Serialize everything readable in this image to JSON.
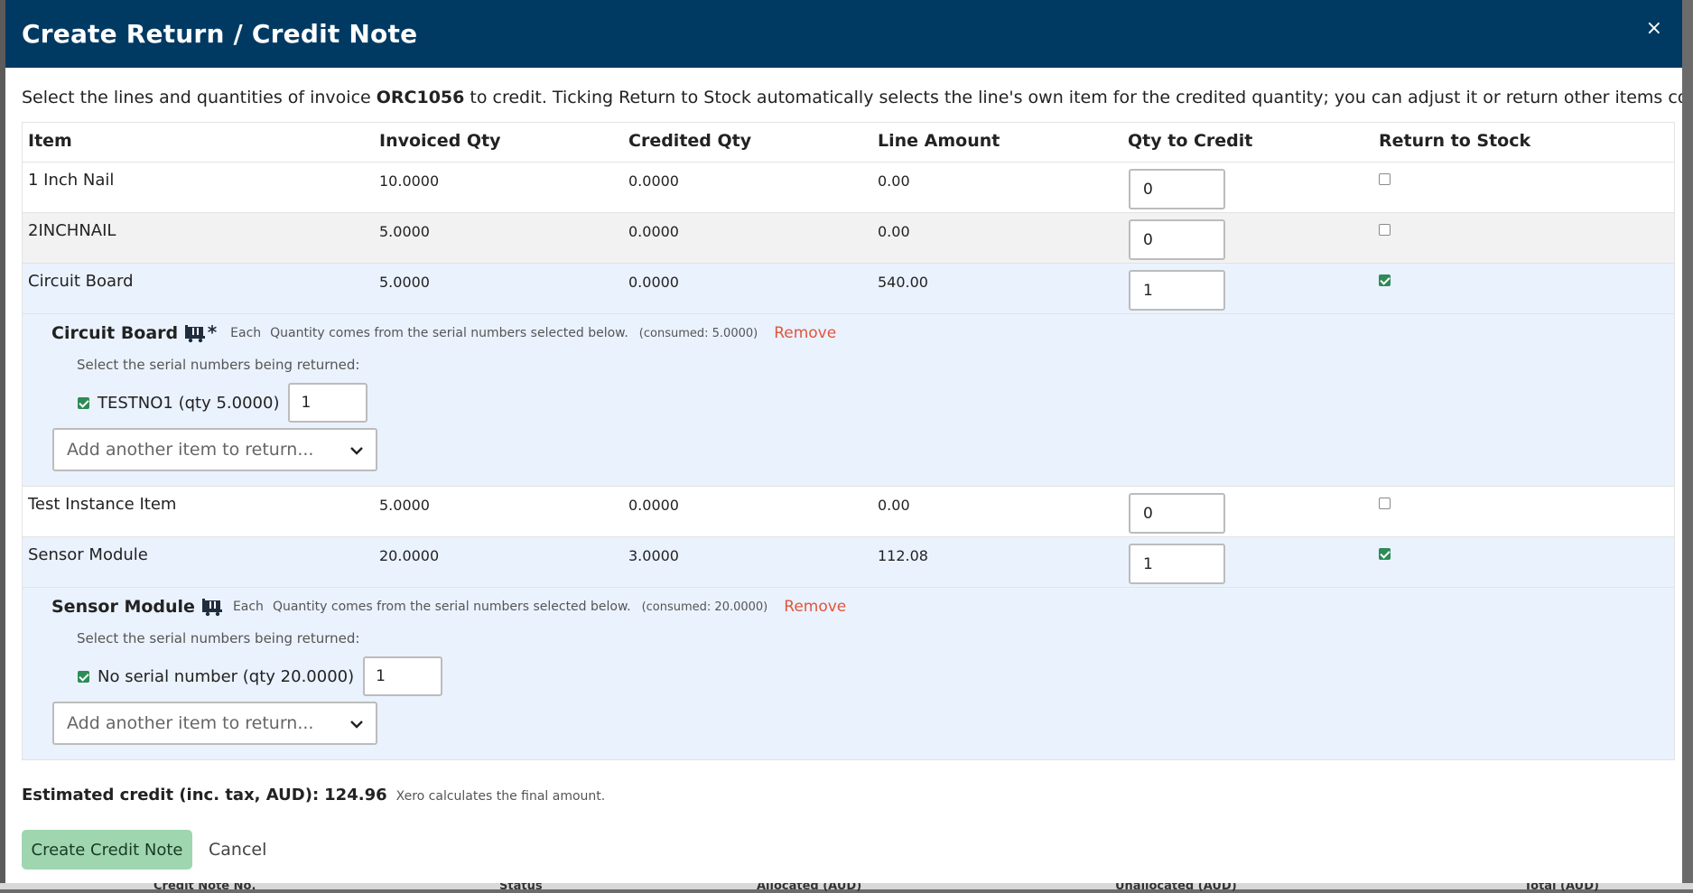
{
  "modal": {
    "title": "Create Return / Credit Note",
    "close_glyph": "×",
    "intro_before": "Select the lines and quantities of invoice ",
    "invoice_number": "ORC1056",
    "intro_after": " to credit. Ticking Return to Stock automatically selects the line's own item for the credited quantity; you can adjust it or return other items consumed on the job."
  },
  "table": {
    "headers": {
      "item": "Item",
      "invoiced_qty": "Invoiced Qty",
      "credited_qty": "Credited Qty",
      "line_amount": "Line Amount",
      "qty_to_credit": "Qty to Credit",
      "return_to_stock": "Return to Stock"
    },
    "rows": [
      {
        "item": "1 Inch Nail",
        "invoiced_qty": "10.0000",
        "credited_qty": "0.0000",
        "line_amount": "0.00",
        "qty_to_credit": "0",
        "return_to_stock": false
      },
      {
        "item": "2INCHNAIL",
        "invoiced_qty": "5.0000",
        "credited_qty": "0.0000",
        "line_amount": "0.00",
        "qty_to_credit": "0",
        "return_to_stock": false
      },
      {
        "item": "Circuit Board",
        "invoiced_qty": "5.0000",
        "credited_qty": "0.0000",
        "line_amount": "540.00",
        "qty_to_credit": "1",
        "return_to_stock": true
      },
      {
        "item": "Test Instance Item",
        "invoiced_qty": "5.0000",
        "credited_qty": "0.0000",
        "line_amount": "0.00",
        "qty_to_credit": "0",
        "return_to_stock": false
      },
      {
        "item": "Sensor Module",
        "invoiced_qty": "20.0000",
        "credited_qty": "3.0000",
        "line_amount": "112.08",
        "qty_to_credit": "1",
        "return_to_stock": true
      }
    ],
    "details": [
      {
        "name": "Circuit Board",
        "icon": "cart-star-icon",
        "unit": "Each",
        "note": "Quantity comes from the serial numbers selected below.",
        "consumed": "(consumed: 5.0000)",
        "remove_label": "Remove",
        "sub_label": "Select the serial numbers being returned:",
        "serial_label": "TESTNO1 (qty 5.0000)",
        "serial_checked": true,
        "serial_qty": "1",
        "add_placeholder": "Add another item to return..."
      },
      {
        "name": "Sensor Module",
        "icon": "cart-icon",
        "unit": "Each",
        "note": "Quantity comes from the serial numbers selected below.",
        "consumed": "(consumed: 20.0000)",
        "remove_label": "Remove",
        "sub_label": "Select the serial numbers being returned:",
        "serial_label": "No serial number (qty 20.0000)",
        "serial_checked": true,
        "serial_qty": "1",
        "add_placeholder": "Add another item to return..."
      }
    ]
  },
  "estimate": {
    "label": "Estimated credit (inc. tax, AUD):",
    "value": "124.96",
    "note": "Xero calculates the final amount."
  },
  "footer": {
    "create_label": "Create Credit Note",
    "cancel_label": "Cancel"
  },
  "background": {
    "columns": [
      "Credit Note No.",
      "Status",
      "Allocated (AUD)",
      "Unallocated (AUD)",
      "Total (AUD)"
    ]
  },
  "colors": {
    "header_bg": "#003a63",
    "primary_button": "#9fd6b0",
    "remove_link": "#e0553d",
    "selected_row": "#eaf2fd",
    "checkbox_on": "#2e8b57"
  }
}
